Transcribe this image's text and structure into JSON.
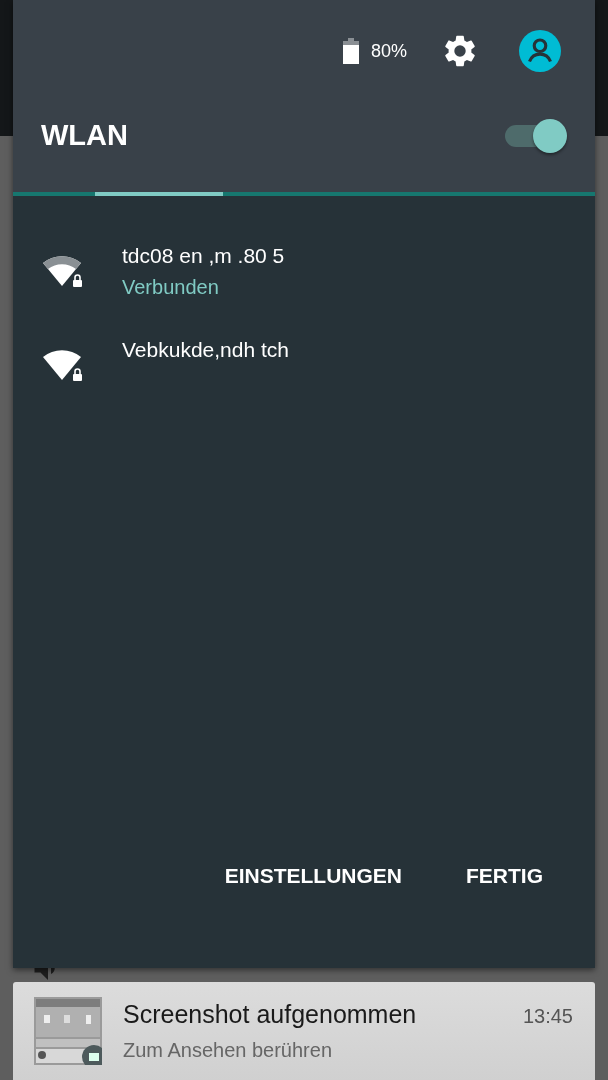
{
  "status": {
    "battery": "80%"
  },
  "wlan": {
    "title": "WLAN",
    "on": true
  },
  "networks": [
    {
      "name": "tdc08 en ,m .80 5",
      "status": "Verbunden"
    },
    {
      "name": "Vebkukde,ndh tch"
    }
  ],
  "buttons": [
    "EINSTELLUNGEN",
    "FERTIG"
  ],
  "notification": {
    "title": "Screenshot aufgenommen",
    "text": "Zum Ansehen berühren",
    "time": "13:45"
  }
}
